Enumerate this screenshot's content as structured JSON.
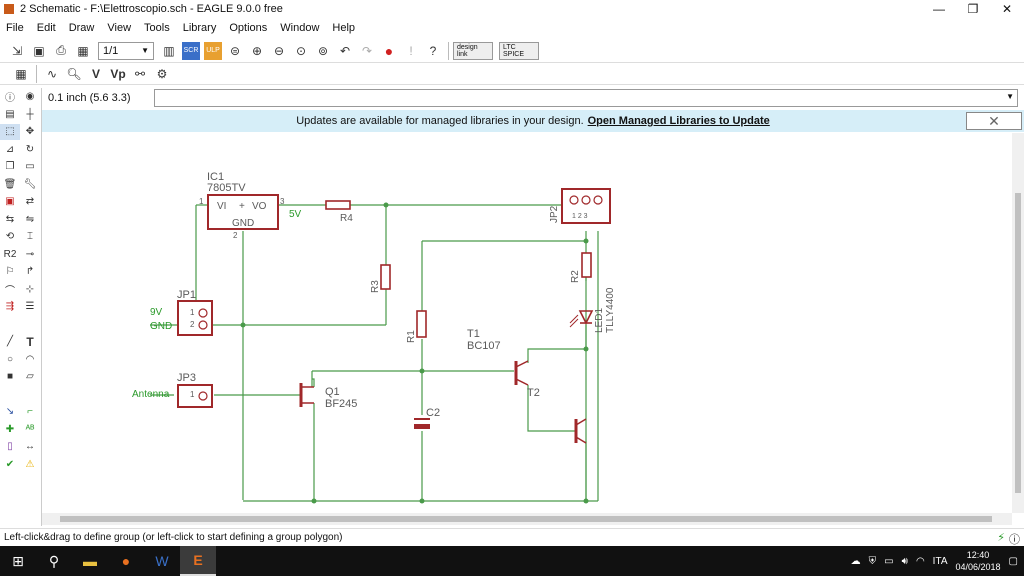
{
  "window": {
    "title": "2 Schematic - F:\\Elettroscopio.sch - EAGLE 9.0.0 free",
    "minimize": "—",
    "maximize": "❐",
    "close": "✕"
  },
  "menu": [
    "File",
    "Edit",
    "Draw",
    "View",
    "Tools",
    "Library",
    "Options",
    "Window",
    "Help"
  ],
  "toolbar": {
    "sheet_select": "1/1",
    "design_link": "design link",
    "ltc_spice": "LTC SPICE"
  },
  "coord": "0.1 inch (5.6 3.3)",
  "command_placeholder": "",
  "notice": {
    "text": "Updates are available for managed libraries in your design.",
    "link": "Open Managed Libraries to Update",
    "close": "✕"
  },
  "status": {
    "message": "Left-click&drag to define group (or left-click to start defining a group polygon)"
  },
  "taskbar": {
    "lang": "ITA",
    "time": "12:40",
    "date": "04/06/2018"
  },
  "schematic": {
    "ic1_name": "IC1",
    "ic1_value": "7805TV",
    "ic1_vi": "VI",
    "ic1_plus": "+",
    "ic1_vo": "VO",
    "ic1_gnd": "GND",
    "ic1_p1": "1",
    "ic1_p2": "2",
    "ic1_p3": "3",
    "net_5v": "5V",
    "r4": "R4",
    "r3": "R3",
    "r1": "R1",
    "r2": "R2",
    "jp2": "JP2",
    "jp2_pins": "1 2 3",
    "jp1": "JP1",
    "jp1_p1": "1",
    "jp1_p2": "2",
    "label_9v": "9V",
    "label_gnd": "GND",
    "jp3": "JP3",
    "jp3_p1": "1",
    "label_antenna": "Antenna",
    "q1_name": "Q1",
    "q1_value": "BF245",
    "t1_name": "T1",
    "t1_value": "BC107",
    "t2_name": "T2",
    "c2": "C2",
    "led1": "LED1",
    "led1_value": "TLLY4400"
  },
  "colors": {
    "wire": "#4a9a4a",
    "part": "#a0282a",
    "label": "#5a5a5a",
    "notice_bg": "#d6eef8"
  }
}
